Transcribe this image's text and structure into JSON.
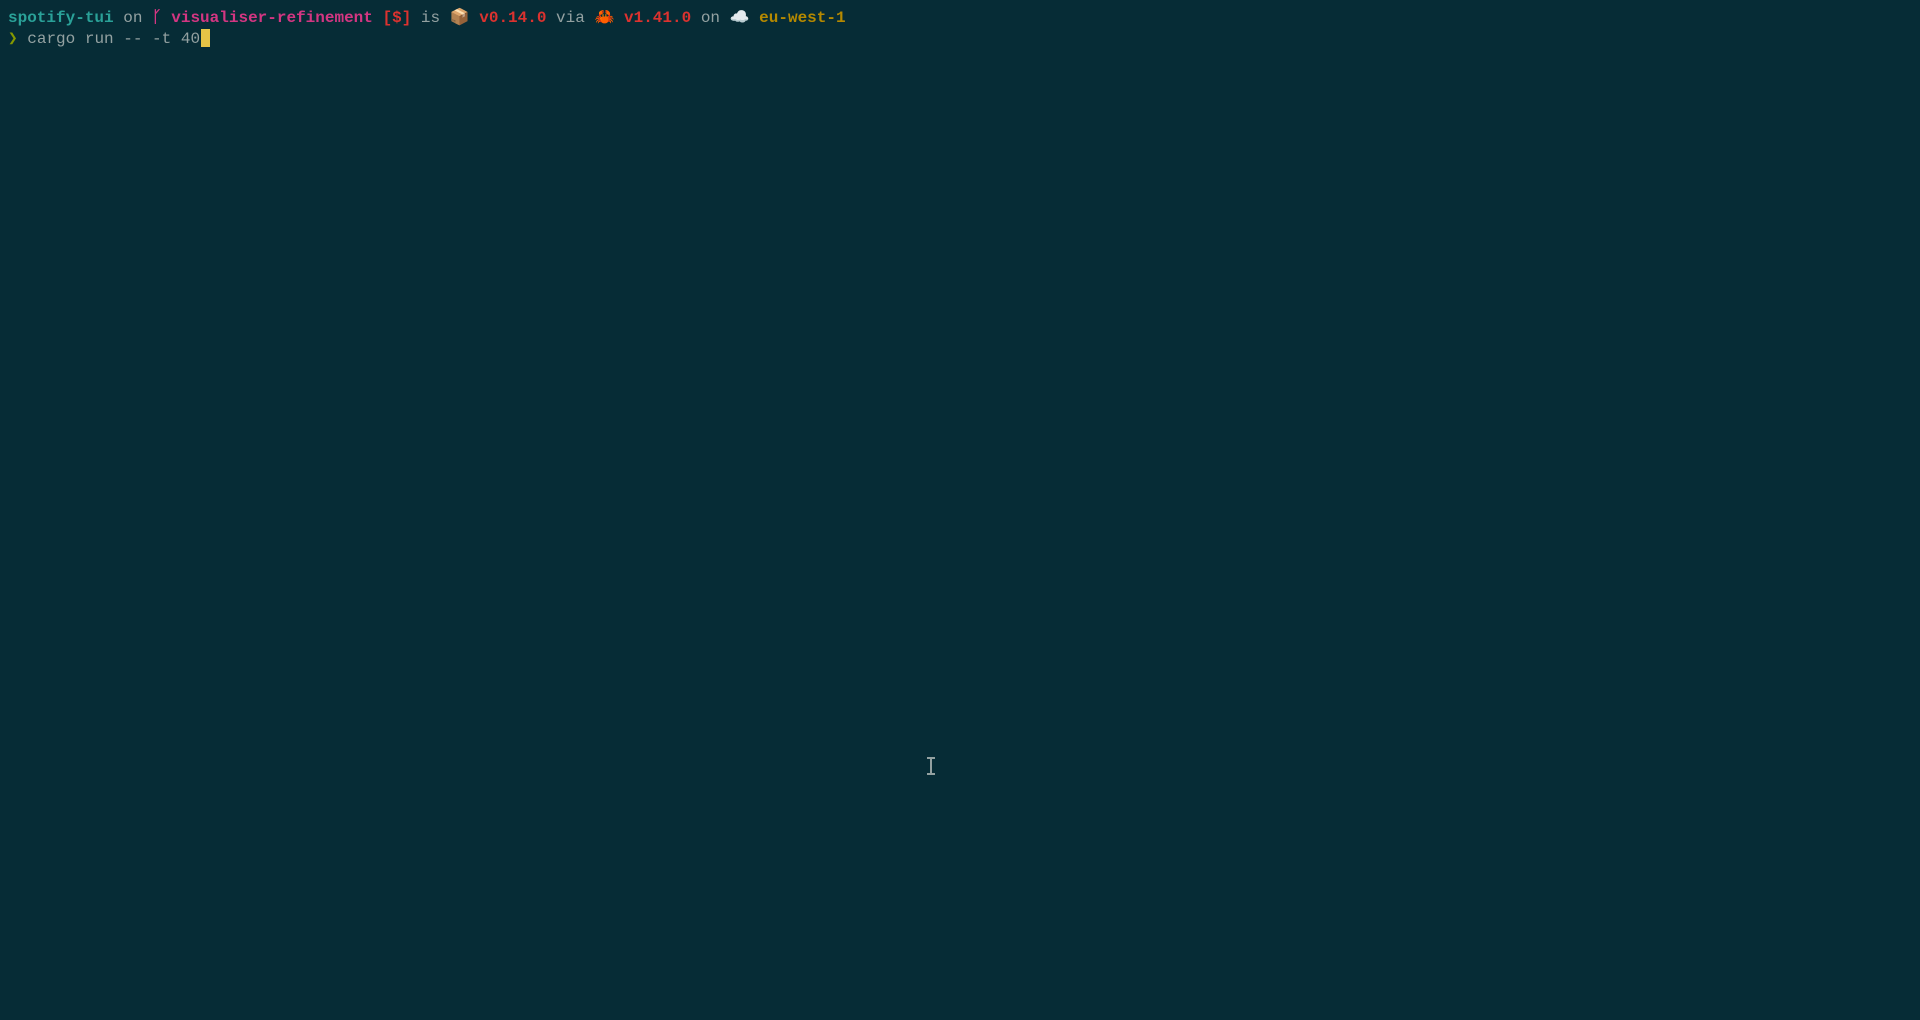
{
  "prompt": {
    "directory": "spotify-tui",
    "sep_on1": " on ",
    "branch_icon": "ᚴ",
    "branch": "visualiser-refinement",
    "git_status": " [$]",
    "sep_is": " is ",
    "package_icon": "📦 ",
    "package_version": "v0.14.0",
    "sep_via": " via ",
    "rust_icon": "🦀 ",
    "rust_version": "v1.41.0",
    "sep_on2": " on ",
    "cloud_icon": "☁️ ",
    "aws_region": "eu-west-1"
  },
  "command_line": {
    "arrow": "❯ ",
    "command": "cargo run -- -t 40"
  }
}
